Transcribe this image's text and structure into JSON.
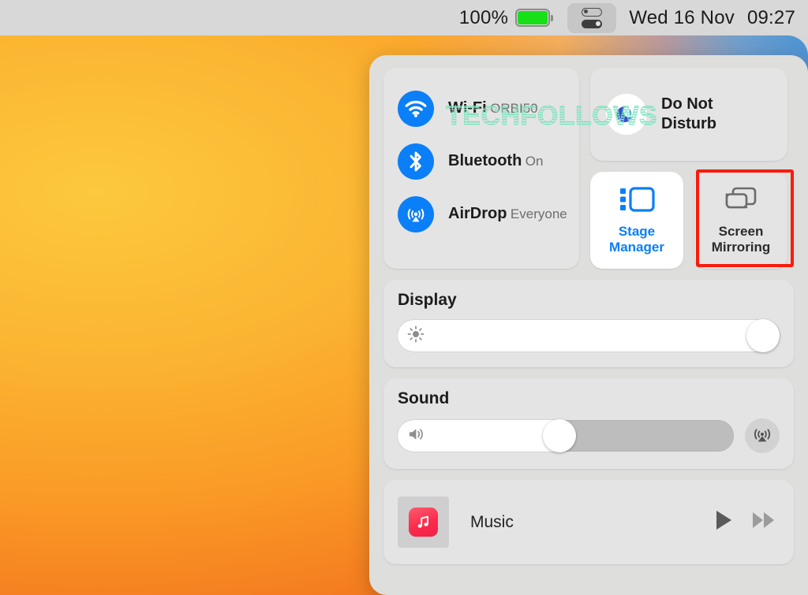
{
  "menubar": {
    "battery_percent": "100%",
    "battery_level": 100,
    "battery_color": "#17e017",
    "control_center_icon": "control-center-toggles-icon",
    "date": "Wed 16 Nov",
    "time": "09:27"
  },
  "control_center": {
    "connectivity": [
      {
        "icon": "wifi-icon",
        "title": "Wi-Fi",
        "status": "ORBI50",
        "active": true
      },
      {
        "icon": "bluetooth-icon",
        "title": "Bluetooth",
        "status": "On",
        "active": true
      },
      {
        "icon": "airdrop-icon",
        "title": "AirDrop",
        "status": "Everyone",
        "active": true
      }
    ],
    "do_not_disturb": {
      "icon": "moon-icon",
      "label": "Do Not\nDisturb",
      "label_line1": "Do Not",
      "label_line2": "Disturb",
      "active": false
    },
    "tiles": [
      {
        "icon": "stage-manager-icon",
        "label_line1": "Stage",
        "label_line2": "Manager",
        "active": true,
        "highlighted": false
      },
      {
        "icon": "screen-mirroring-icon",
        "label_line1": "Screen",
        "label_line2": "Mirroring",
        "active": false,
        "highlighted": true
      }
    ],
    "display": {
      "title": "Display",
      "icon": "brightness-sun-icon",
      "value": 100
    },
    "sound": {
      "title": "Sound",
      "icon": "speaker-volume-icon",
      "value": 53,
      "airplay_icon": "airplay-audio-icon"
    },
    "music": {
      "app_icon": "music-app-icon",
      "name": "Music",
      "play_icon": "play-icon",
      "forward_icon": "fast-forward-icon"
    }
  },
  "annotation": {
    "color": "#f81c0e",
    "target": "screen-mirroring-tile"
  },
  "watermark": {
    "text": "TECHFOLLOWS",
    "color": "#7fe3bf"
  }
}
